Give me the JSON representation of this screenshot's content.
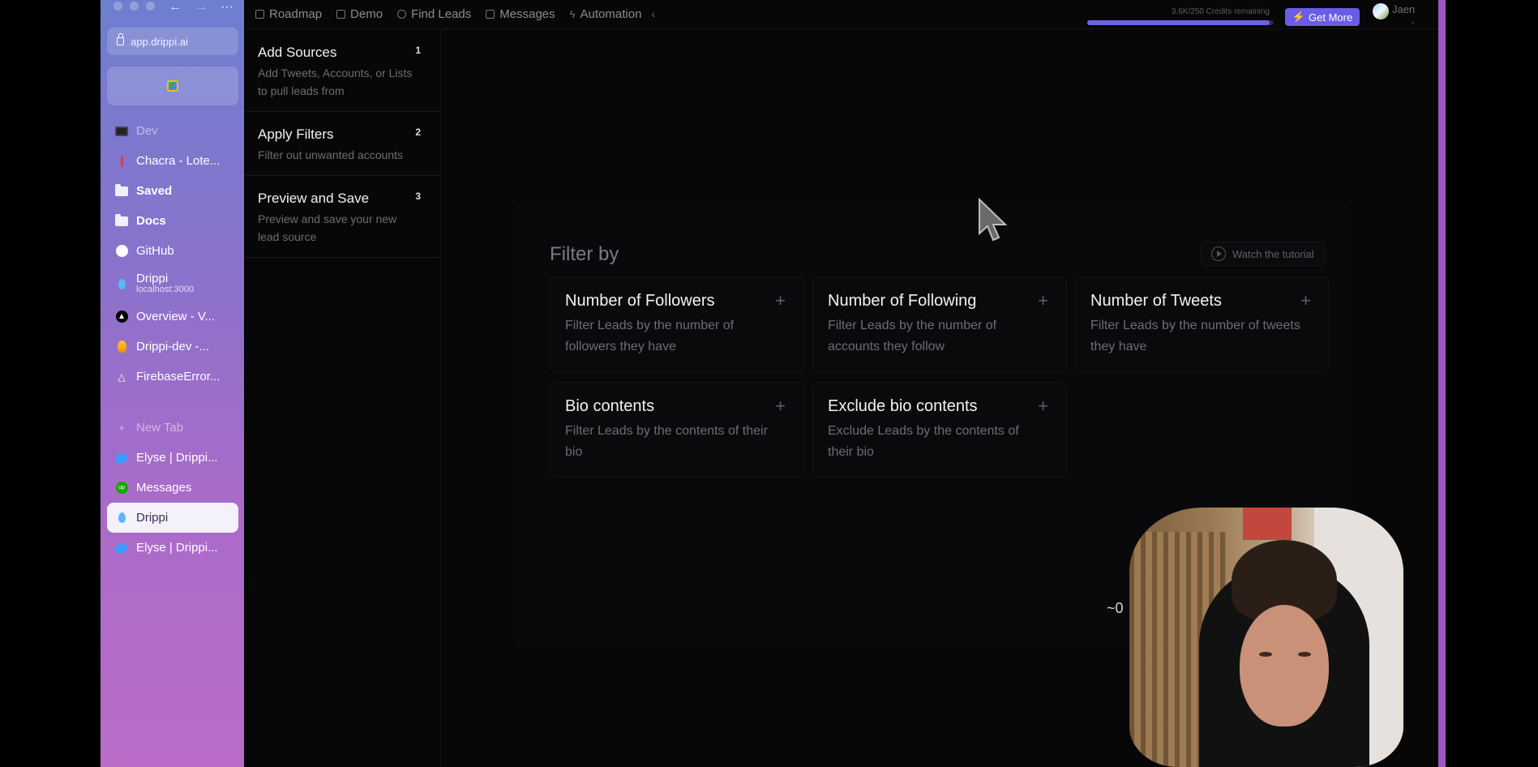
{
  "browser": {
    "url": "app.drippi.ai",
    "tabs": [
      {
        "label": "Dev",
        "style": "dim",
        "icon": "monitor-icon"
      },
      {
        "label": "Chacra - Lote...",
        "style": "normal",
        "icon": "red-bar-icon"
      },
      {
        "label": "Saved",
        "style": "bold",
        "icon": "folder-icon"
      },
      {
        "label": "Docs",
        "style": "bold",
        "icon": "folder-icon"
      },
      {
        "label": "GitHub",
        "style": "normal",
        "icon": "github-icon"
      },
      {
        "label": "Drippi",
        "sub": "localhost:3000",
        "style": "normal",
        "icon": "drop-icon"
      },
      {
        "label": "Overview - V...",
        "style": "normal",
        "icon": "vercel-icon"
      },
      {
        "label": "Drippi-dev -...",
        "style": "normal",
        "icon": "firebase-icon"
      },
      {
        "label": "FirebaseError...",
        "style": "normal",
        "icon": "a-icon"
      }
    ],
    "new_tab_label": "New Tab",
    "lower_tabs": [
      {
        "label": "Elyse | Drippi...",
        "icon": "bird-icon"
      },
      {
        "label": "Messages",
        "icon": "upwork-icon"
      },
      {
        "label": "Drippi",
        "icon": "drop-icon",
        "active": true
      },
      {
        "label": "Elyse | Drippi...",
        "icon": "bird-icon"
      }
    ]
  },
  "topnav": {
    "items": [
      "Roadmap",
      "Demo",
      "Find Leads",
      "Messages",
      "Automation"
    ],
    "credits_text": "3.6K/250 Credits remaining",
    "credits_fraction": 0.98,
    "get_more_label": "Get More",
    "user_name": "Jaen"
  },
  "steps": [
    {
      "title": "Add Sources",
      "num": "1",
      "desc": "Add Tweets, Accounts, or Lists to pull leads from"
    },
    {
      "title": "Apply Filters",
      "num": "2",
      "desc": "Filter out unwanted accounts"
    },
    {
      "title": "Preview and Save",
      "num": "3",
      "desc": "Preview and save your new lead source"
    }
  ],
  "filter": {
    "heading": "Filter by",
    "tutorial_label": "Watch the tutorial",
    "cards": [
      {
        "title": "Number of Followers",
        "desc": "Filter Leads by the number of followers they have"
      },
      {
        "title": "Number of Following",
        "desc": "Filter Leads by the number of accounts they follow"
      },
      {
        "title": "Number of Tweets",
        "desc": "Filter Leads by the number of tweets they have"
      },
      {
        "title": "Bio contents",
        "desc": "Filter Leads by the contents of their bio"
      },
      {
        "title": "Exclude bio contents",
        "desc": "Exclude Leads by the contents of their bio"
      }
    ]
  },
  "overlay_text": "~0",
  "colors": {
    "accent": "#6b5ce7",
    "sidebar_top": "#6e7fcf",
    "sidebar_bottom": "#b86cc8",
    "background": "#070708"
  }
}
